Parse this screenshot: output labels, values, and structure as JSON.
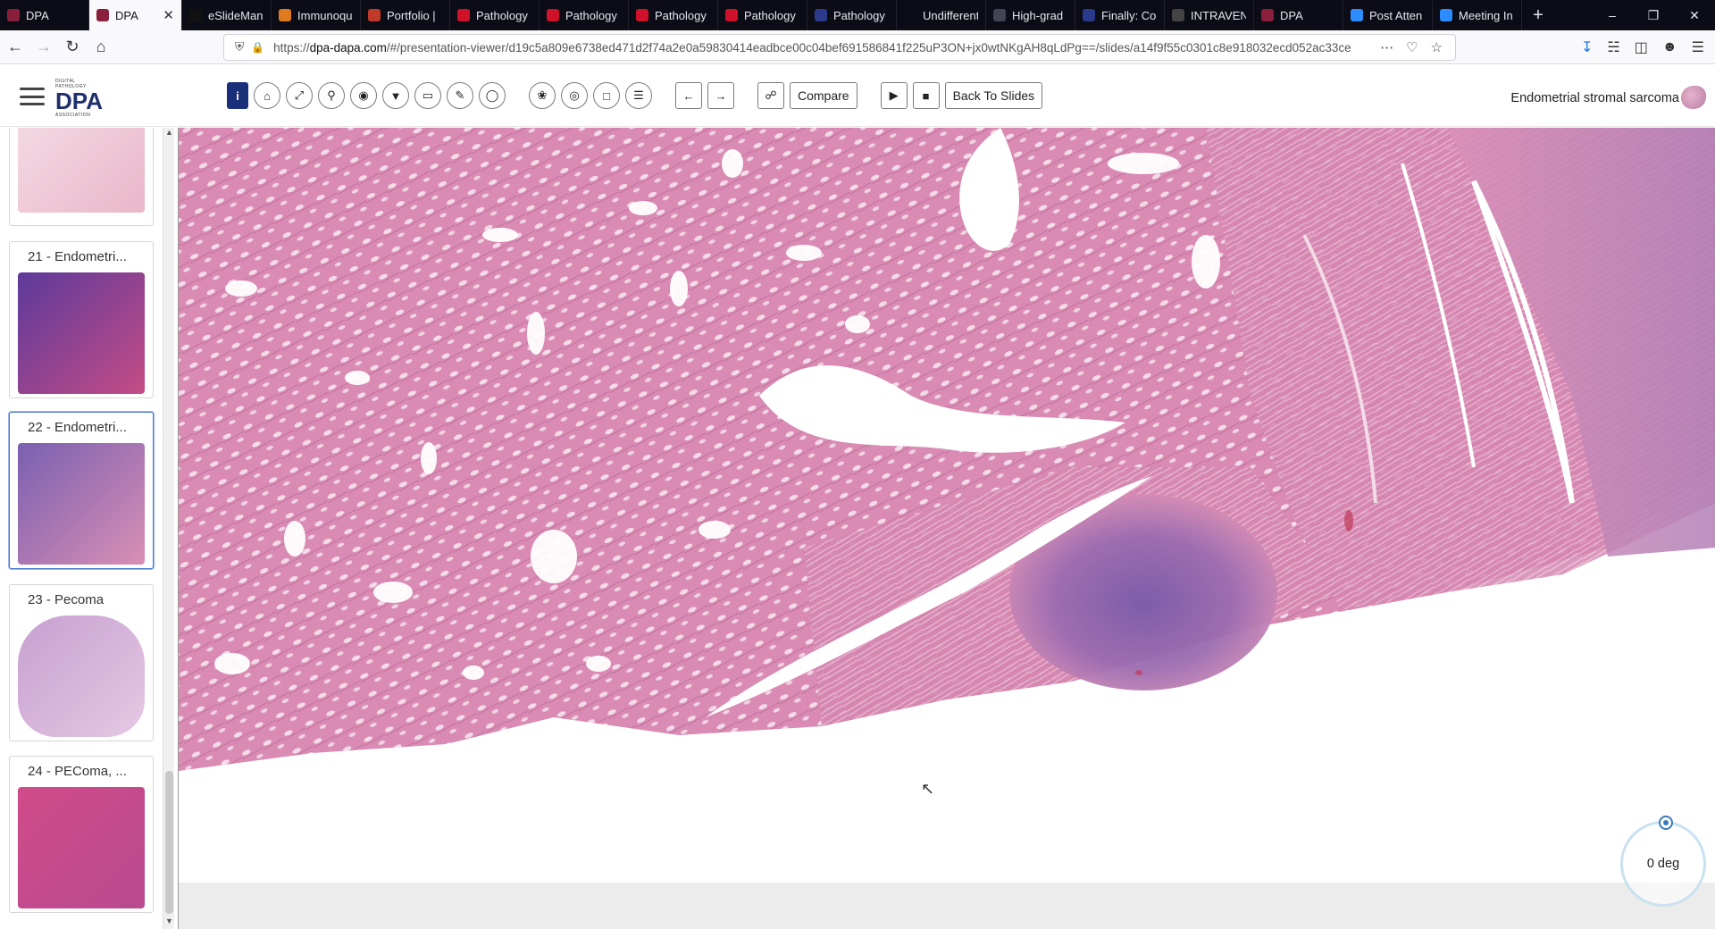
{
  "browser": {
    "tabs": [
      {
        "label": "DPA",
        "fav_color": "#8a1f3c"
      },
      {
        "label": "DPA",
        "fav_color": "#8a1f3c",
        "active": true
      },
      {
        "label": "eSlideMan",
        "fav_color": "#111"
      },
      {
        "label": "Immunoqu",
        "fav_color": "#e07a1f"
      },
      {
        "label": "Portfolio |",
        "fav_color": "#c0392b"
      },
      {
        "label": "Pathology",
        "fav_color": "#d0112b"
      },
      {
        "label": "Pathology",
        "fav_color": "#d0112b"
      },
      {
        "label": "Pathology",
        "fav_color": "#d0112b"
      },
      {
        "label": "Pathology",
        "fav_color": "#d0112b"
      },
      {
        "label": "Pathology",
        "fav_color": "#2b3a8a"
      },
      {
        "label": "Undifferentiate",
        "fav_color": ""
      },
      {
        "label": "High-grad",
        "fav_color": "#445"
      },
      {
        "label": "Finally: Co",
        "fav_color": "#2b3a8a"
      },
      {
        "label": "INTRAVEN",
        "fav_color": "#444"
      },
      {
        "label": "DPA",
        "fav_color": "#8a1f3c"
      },
      {
        "label": "Post Atten",
        "fav_color": "#2d8cff"
      },
      {
        "label": "Meeting In",
        "fav_color": "#2d8cff"
      }
    ],
    "url_prefix": "https://",
    "url_domain": "dpa-dapa.com",
    "url_path": "/#/presentation-viewer/d19c5a809e6738ed471d2f74a2e0a59830414eadbce00c04bef691586841f225uP3ON+jx0wtNKgAH8qLdPg==/slides/a14f9f55c0301c8e918032ecd052ac33ce"
  },
  "app": {
    "logo_small": "DIGITAL PATHOLOGY",
    "logo_big": "DPA",
    "logo_bottom": "ASSOCIATION",
    "compare_label": "Compare",
    "back_label": "Back To Slides",
    "slide_title": "Endometrial stromal sarcoma"
  },
  "slides": [
    {
      "title": "",
      "colors": [
        "#f3d9e3",
        "#e9b7c9"
      ]
    },
    {
      "title": "21 - Endometri...",
      "colors": [
        "#5c3a9a",
        "#c44c86"
      ]
    },
    {
      "title": "22 - Endometri...",
      "colors": [
        "#7a5fb0",
        "#d98fb5"
      ],
      "active": true
    },
    {
      "title": "23 - Pecoma",
      "colors": [
        "#c7a0d0",
        "#e5c8e4"
      ]
    },
    {
      "title": "24 - PEComa, ...",
      "colors": [
        "#d14b8a",
        "#b84a90"
      ]
    }
  ],
  "viewer": {
    "rotation_label": "0 deg"
  }
}
